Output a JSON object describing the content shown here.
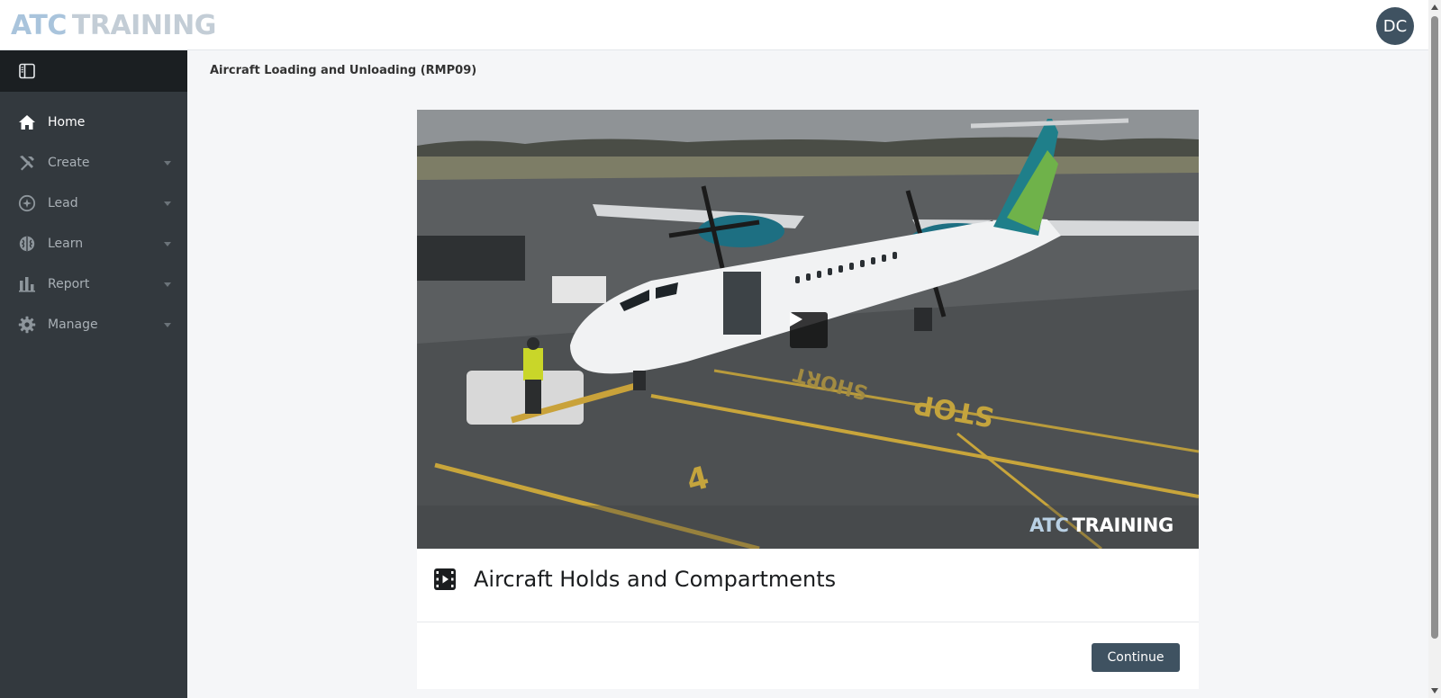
{
  "brand": {
    "logo_part1": "ATC",
    "logo_part2": "TRAINING"
  },
  "user": {
    "initials": "DC"
  },
  "sidebar": {
    "toggle_icon": "sidebar-toggle-icon",
    "items": [
      {
        "label": "Home",
        "icon": "home-icon",
        "active": true
      },
      {
        "label": "Create",
        "icon": "tools-icon",
        "expandable": true
      },
      {
        "label": "Lead",
        "icon": "compass-icon",
        "expandable": true
      },
      {
        "label": "Learn",
        "icon": "brain-icon",
        "expandable": true
      },
      {
        "label": "Report",
        "icon": "bar-chart-icon",
        "expandable": true
      },
      {
        "label": "Manage",
        "icon": "gear-icon",
        "expandable": true
      }
    ]
  },
  "main": {
    "breadcrumb": "Aircraft Loading and Unloading (RMP09)",
    "video": {
      "watermark_part1": "ATC",
      "watermark_part2": "TRAINING",
      "play_icon": "play-icon",
      "runway_markings": [
        "STOP",
        "SHORT",
        "4"
      ]
    },
    "lesson": {
      "icon": "film-icon",
      "title": "Aircraft Holds and Compartments"
    },
    "continue_label": "Continue"
  },
  "colors": {
    "sidebar": "#33393e",
    "sidebar_head": "#1b1f22",
    "accent": "#3f5261",
    "main_bg": "#f5f6f8"
  }
}
